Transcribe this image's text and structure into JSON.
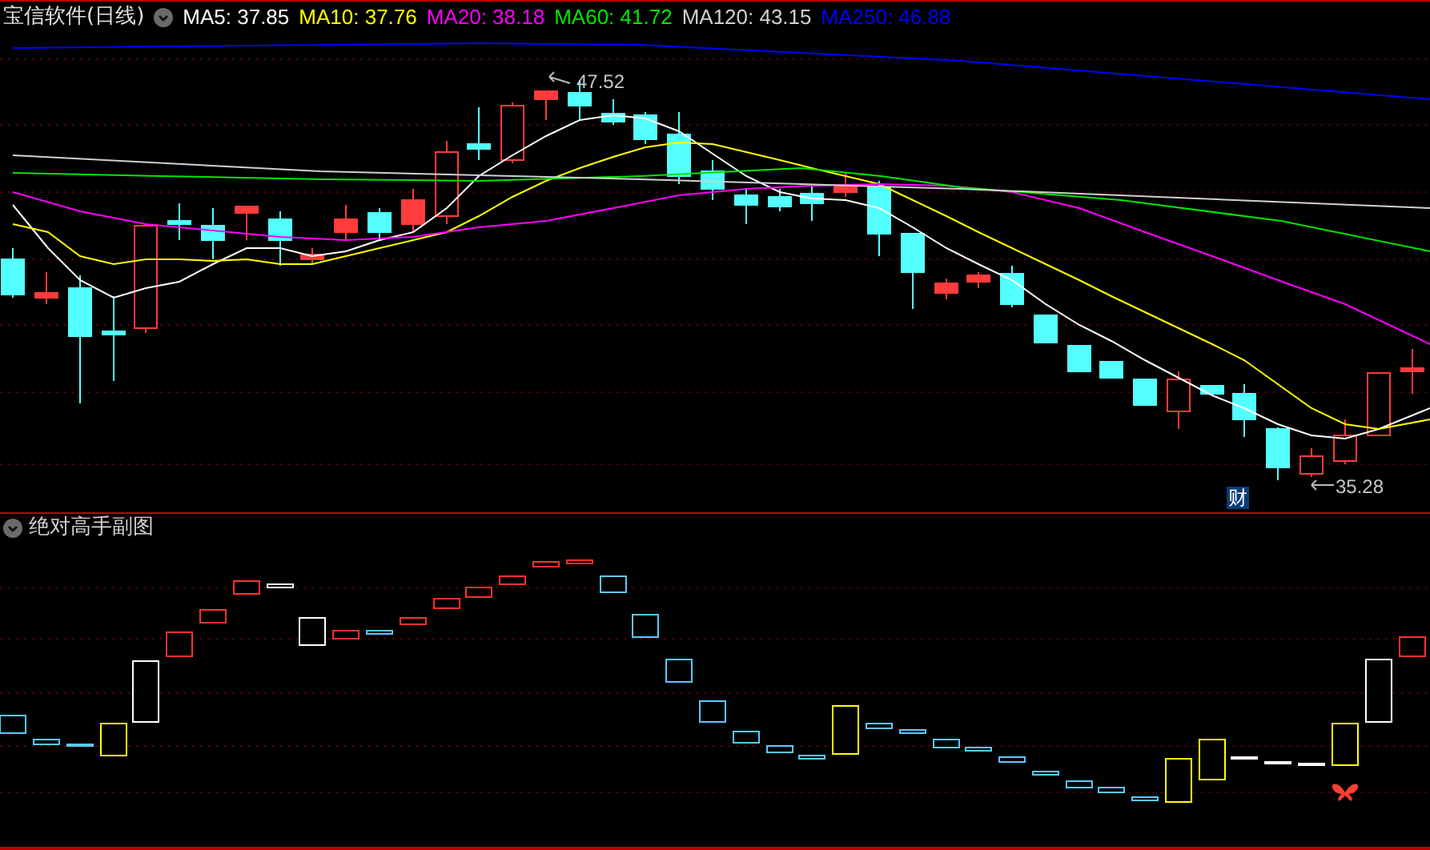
{
  "title": "宝信软件(日线)",
  "moving_averages": [
    {
      "label": "MA5: 37.85",
      "color": "#ffffff"
    },
    {
      "label": "MA10: 37.76",
      "color": "#ffff00"
    },
    {
      "label": "MA20: 38.18",
      "color": "#ff00ff"
    },
    {
      "label": "MA60: 41.72",
      "color": "#00e600"
    },
    {
      "label": "MA120: 43.15",
      "color": "#d0d0d0"
    },
    {
      "label": "MA250: 46.88",
      "color": "#0000ff"
    }
  ],
  "high_marker": "47.52",
  "low_marker": "35.28",
  "badge": "财",
  "sub_panel": {
    "title": "绝对高手副图"
  }
}
